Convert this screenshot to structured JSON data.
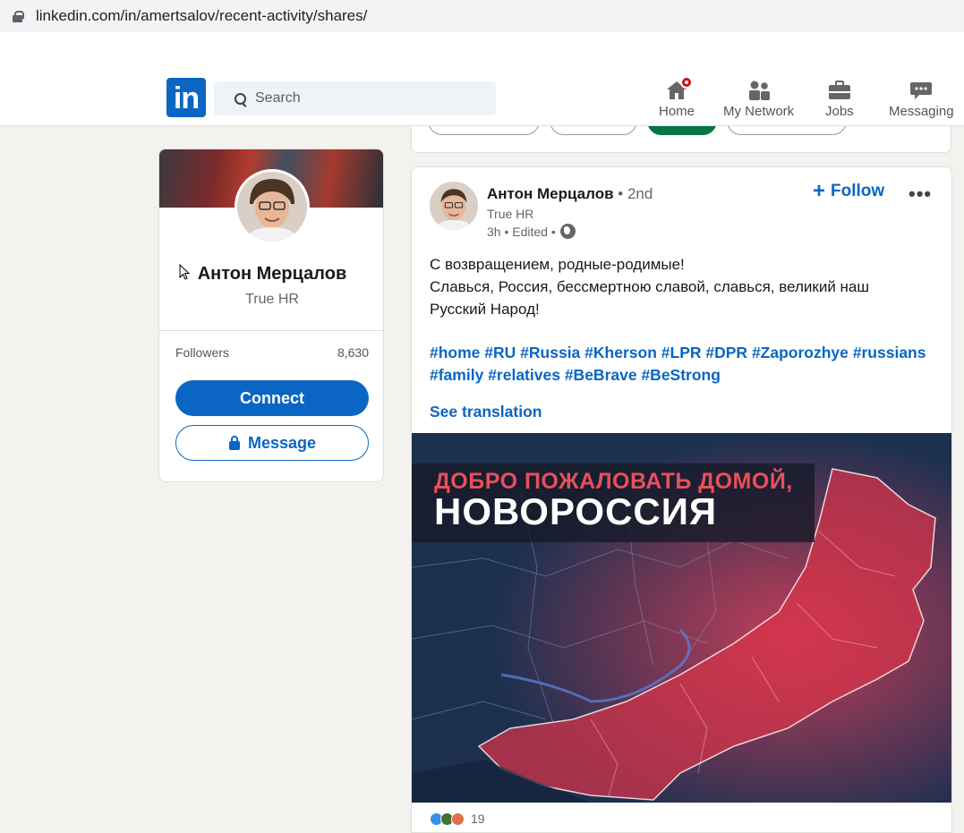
{
  "browser": {
    "url": "linkedin.com/in/amertsalov/recent-activity/shares/"
  },
  "header": {
    "logo_text": "in",
    "search_placeholder": "Search",
    "nav": [
      {
        "label": "Home",
        "icon": "home-icon"
      },
      {
        "label": "My Network",
        "icon": "network-icon"
      },
      {
        "label": "Jobs",
        "icon": "briefcase-icon"
      },
      {
        "label": "Messaging",
        "icon": "messaging-icon"
      }
    ]
  },
  "profile_card": {
    "name": "Антон Мерцалов",
    "headline": "True HR",
    "followers_label": "Followers",
    "followers_count": "8,630",
    "connect_label": "Connect",
    "message_label": "Message"
  },
  "post": {
    "author_name": "Антон Мерцалов",
    "degree": "• 2nd",
    "author_headline": "True HR",
    "meta": "3h • Edited •",
    "follow_label": "Follow",
    "more_label": "•••",
    "text_lines": [
      "С возвращением, родные-родимые!",
      "Славься, Россия, бессмертною славой, славься, великий наш",
      "Русский Народ!"
    ],
    "hashtags_line1": [
      "#home",
      "#RU",
      "#Russia",
      "#Kherson",
      "#LPR",
      "#DPR",
      "#Zaporozhye",
      "#russians"
    ],
    "hashtags_line2": [
      "#family",
      "#relatives",
      "#BeBrave",
      "#BeStrong"
    ],
    "see_translation": "See translation",
    "image": {
      "line1": "ДОБРО ПОЖАЛОВАТЬ ДОМОЙ,",
      "line2": "НОВОРОССИЯ"
    },
    "reaction_count": "19"
  },
  "colors": {
    "brand": "#0a66c2",
    "badge": "#cc1016",
    "pill_active": "#057642"
  }
}
